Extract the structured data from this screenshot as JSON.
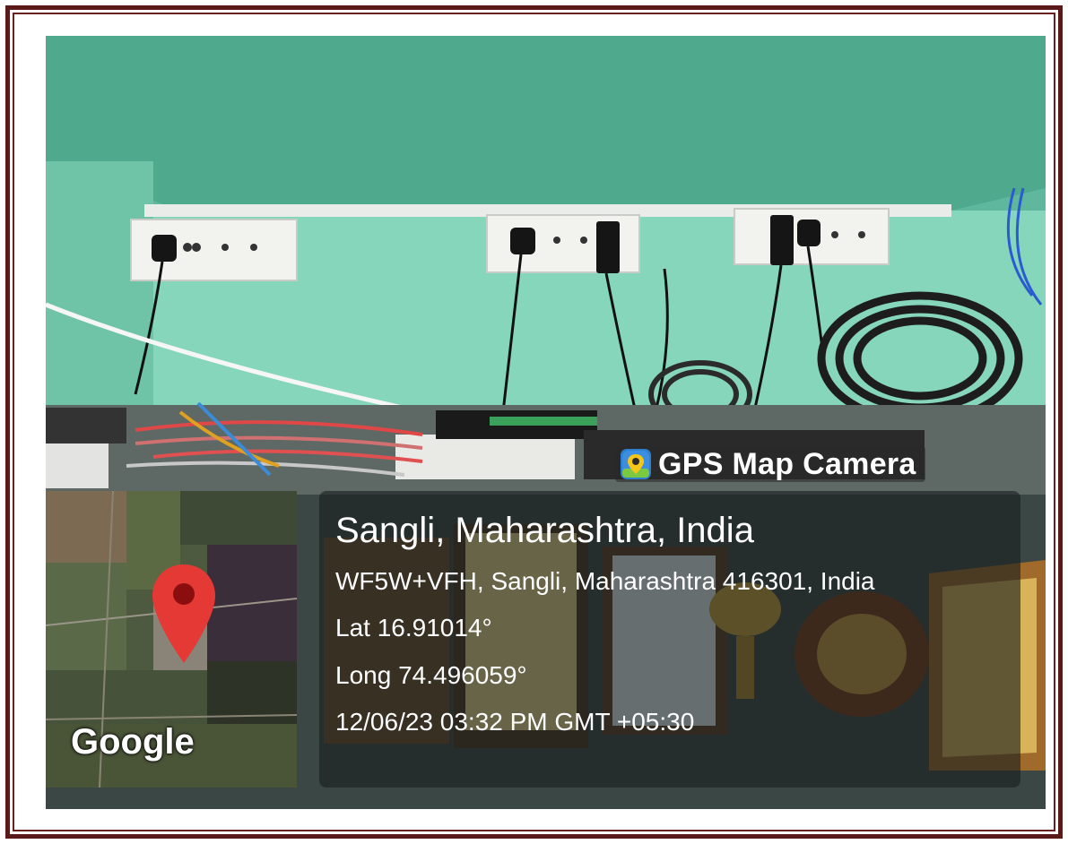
{
  "app": {
    "name": "GPS Map Camera",
    "icon": "gps-map-camera-icon"
  },
  "location": {
    "city": "Sangli, Maharashtra, India",
    "address": "WF5W+VFH, Sangli, Maharashtra 416301, India",
    "latitude": "Lat 16.91014°",
    "longitude": "Long 74.496059°",
    "timestamp": "12/06/23 03:32 PM GMT +05:30"
  },
  "map": {
    "attribution": "Google",
    "marker_icon": "map-pin-icon"
  },
  "colors": {
    "frame": "#5a1a1a",
    "wall": "#7fcfb2",
    "pin": "#e53935"
  }
}
